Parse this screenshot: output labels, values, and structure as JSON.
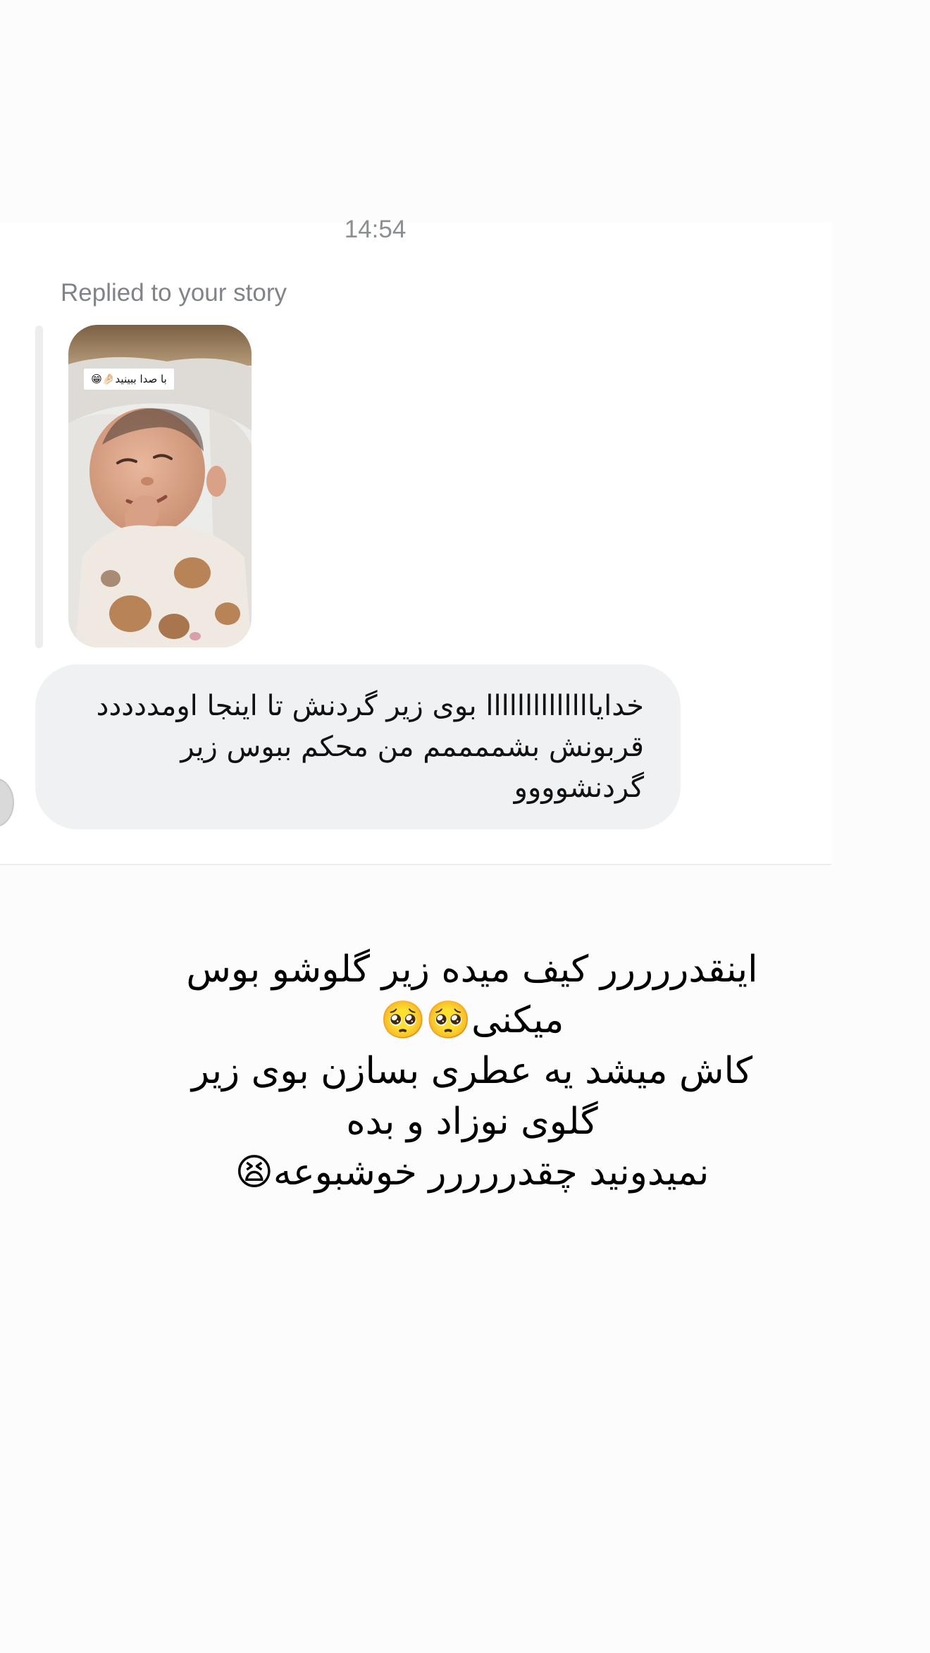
{
  "colors": {
    "page_background": "#fcfcfc",
    "chat_background": "#ffffff",
    "bubble_background": "#f0f1f3",
    "meta_text": "#80848a",
    "reply_bar": "#ededed"
  },
  "chat": {
    "timestamp": "14:54",
    "reply_label": "Replied to your story",
    "story": {
      "sticker_text": "با صدا ببینید🤌🏻😁",
      "thumbnail_icon": "story-thumbnail-image"
    },
    "message": {
      "text": "خدایاااااااااااااا بوی زیر گردنش تا اینجا اومددددد\nقربونش بشممممم من محکم ببوس زیر\nگردنشوووو"
    },
    "avatar_icon": "sender-avatar"
  },
  "caption": {
    "text": "اینقدررررر کیف میده زیر گلوشو بوس\nمیکنی🥺🥺\nکاش میشد یه عطری بسازن بوی زیر\nگلوی نوزاد و بده\nنمیدونید چقدررررر خوشبوعه😫"
  }
}
